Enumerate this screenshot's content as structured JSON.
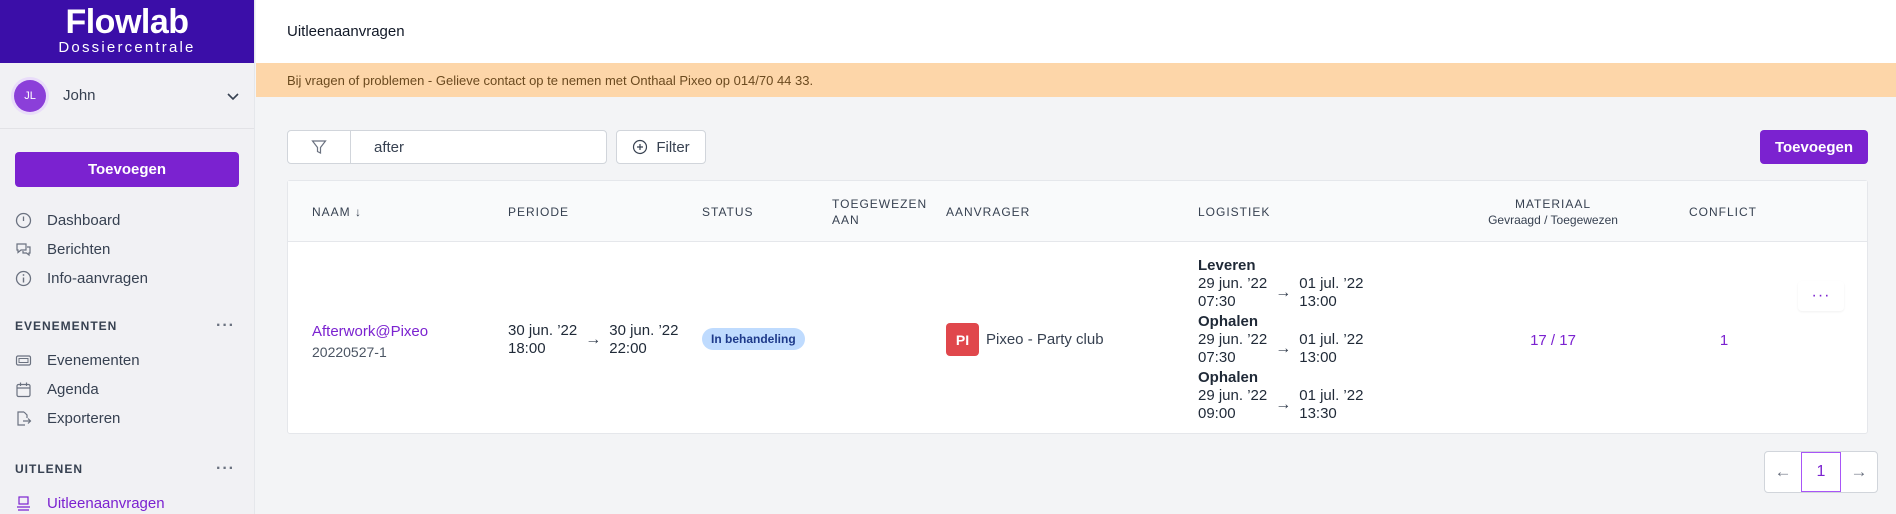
{
  "brand": {
    "name": "Flowlab",
    "subtitle": "Dossiercentrale"
  },
  "user": {
    "initials": "JL",
    "name": "John"
  },
  "sidebar": {
    "add_label": "Toevoegen",
    "main_items": [
      {
        "label": "Dashboard",
        "icon": "dashboard-icon"
      },
      {
        "label": "Berichten",
        "icon": "chat-icon"
      },
      {
        "label": "Info-aanvragen",
        "icon": "info-icon"
      }
    ],
    "sections": [
      {
        "title": "EVENEMENTEN",
        "items": [
          {
            "label": "Evenementen",
            "icon": "ticket-icon"
          },
          {
            "label": "Agenda",
            "icon": "calendar-icon"
          },
          {
            "label": "Exporteren",
            "icon": "export-icon"
          }
        ]
      },
      {
        "title": "UITLENEN",
        "items": [
          {
            "label": "Uitleenaanvragen",
            "icon": "loan-icon",
            "active": true
          }
        ]
      }
    ]
  },
  "header": {
    "title": "Uitleenaanvragen"
  },
  "banner": {
    "text": "Bij vragen of problemen - Gelieve contact op te nemen met Onthaal Pixeo op 014/70 44 33."
  },
  "toolbar": {
    "search_value": "after",
    "filter_label": "Filter",
    "add_label": "Toevoegen"
  },
  "table": {
    "headers": {
      "naam": "NAAM",
      "periode": "PERIODE",
      "status": "STATUS",
      "toegewezen_1": "TOEGEWEZEN",
      "toegewezen_2": "AAN",
      "aanvrager": "AANVRAGER",
      "logistiek": "LOGISTIEK",
      "materiaal": "MATERIAAL",
      "materiaal_sub": "Gevraagd / Toegewezen",
      "conflict": "CONFLICT"
    },
    "row": {
      "name": "Afterwork@Pixeo",
      "id": "20220527-1",
      "period": {
        "start_date": "30 jun. ’22",
        "start_time": "18:00",
        "end_date": "30 jun. ’22",
        "end_time": "22:00"
      },
      "status": "In behandeling",
      "requester_initials": "PI",
      "requester": "Pixeo - Party club",
      "logistics": [
        {
          "label": "Leveren",
          "from_date": "29 jun. ’22",
          "from_time": "07:30",
          "to_date": "01 jul. ’22",
          "to_time": "13:00"
        },
        {
          "label": "Ophalen",
          "from_date": "29 jun. ’22",
          "from_time": "07:30",
          "to_date": "01 jul. ’22",
          "to_time": "13:00"
        },
        {
          "label": "Ophalen",
          "from_date": "29 jun. ’22",
          "from_time": "09:00",
          "to_date": "01 jul. ’22",
          "to_time": "13:30"
        }
      ],
      "materials": "17 / 17",
      "conflict": "1",
      "actions": "···"
    }
  },
  "pagination": {
    "current": "1"
  },
  "colors": {
    "brand": "#3b0ea8",
    "accent": "#7b22d0",
    "banner": "#fdd6a9",
    "badge": "#bfdbfe"
  }
}
